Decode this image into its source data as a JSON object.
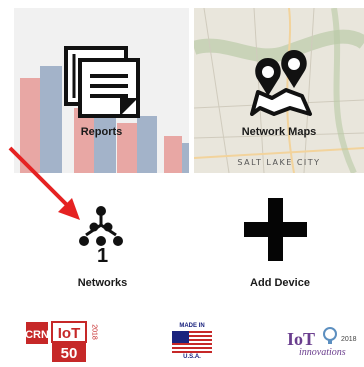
{
  "tiles": {
    "reports": {
      "label": "Reports"
    },
    "maps": {
      "label": "Network Maps",
      "map_city": "SALT LAKE CITY"
    }
  },
  "actions": {
    "networks": {
      "label": "Networks",
      "count": "1"
    },
    "add_device": {
      "label": "Add Device"
    }
  },
  "logos": {
    "crn": {
      "text_crn": "CRN",
      "text_iot": "IoT",
      "text_50": "50",
      "text_year": "2018"
    },
    "usa": {
      "text_top": "MADE IN",
      "text_bottom": "U.S.A."
    },
    "iot_innovations": {
      "text_iot": "IoT",
      "text_innov": "innovations",
      "text_year": "2018"
    }
  },
  "colors": {
    "accent_arrow": "#e52222",
    "bar_red": "#e8a7a4",
    "bar_blue": "#a3b3c9",
    "icon_black": "#111111"
  },
  "icons": {
    "reports": "report-document-icon",
    "maps": "map-pins-icon",
    "networks": "network-tree-icon",
    "add": "plus-icon"
  }
}
